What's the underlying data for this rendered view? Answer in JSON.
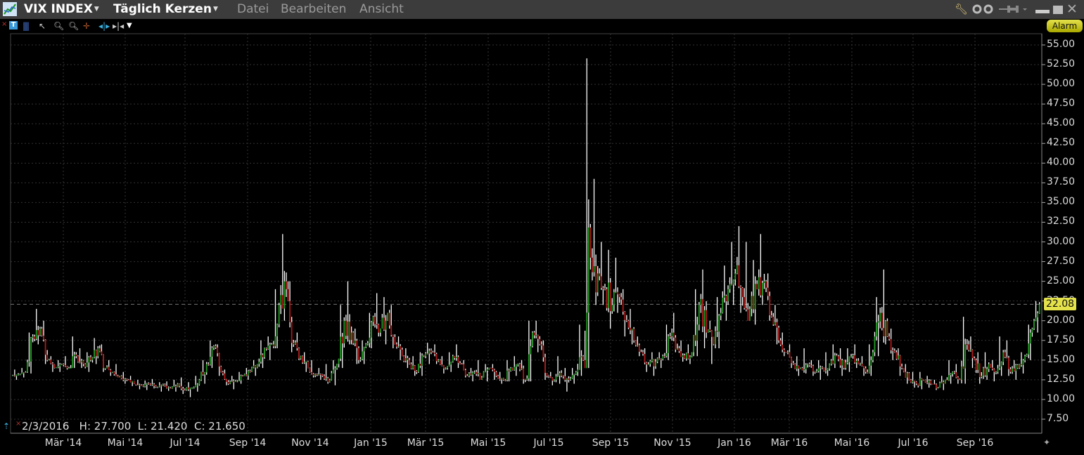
{
  "titlebar": {
    "symbol": "VIX INDEX",
    "chart_type": "Täglich Kerzen",
    "menus": [
      "Datei",
      "Bearbeiten",
      "Ansicht"
    ]
  },
  "alarm_label": "Alarm",
  "info": {
    "date": "2/3/2016",
    "text": "2/3/2016   H: 27.700  L: 21.420  C: 21.650"
  },
  "last_price": "22.08",
  "colors": {
    "up": "#1f9a1f",
    "down": "#b01818",
    "wick": "#ffffff",
    "last": "#e4e24a"
  },
  "chart_data": {
    "type": "candlestick",
    "title": "VIX INDEX",
    "interval": "weekly approximation of daily candles",
    "ylim": [
      5.0,
      57.0
    ],
    "yticks": [
      "55.00",
      "52.50",
      "50.00",
      "47.50",
      "45.00",
      "42.50",
      "40.00",
      "37.50",
      "35.00",
      "32.50",
      "30.00",
      "27.50",
      "25.00",
      "22.50",
      "20.00",
      "17.50",
      "15.00",
      "12.50",
      "10.00",
      "7.50"
    ],
    "xticks": [
      "Mär '14",
      "Mai '14",
      "Jul '14",
      "Sep '14",
      "Nov '14",
      "Jan '15",
      "Mär '15",
      "Mai '15",
      "Jul '15",
      "Sep '15",
      "Nov '15",
      "Jan '16",
      "Mär '16",
      "Mai '16",
      "Jul '16",
      "Sep '16"
    ],
    "last": 22.08,
    "ohlc": [
      [
        13,
        13.8,
        12.5,
        13.2
      ],
      [
        13.2,
        14,
        12.8,
        13.5
      ],
      [
        13.5,
        18.5,
        13.3,
        18
      ],
      [
        18,
        21.5,
        17,
        19
      ],
      [
        19,
        20,
        14.5,
        15
      ],
      [
        15,
        15.5,
        13.5,
        14
      ],
      [
        14,
        15,
        13.5,
        14.5
      ],
      [
        14.5,
        15.5,
        13.8,
        14
      ],
      [
        14,
        18,
        14,
        15.5
      ],
      [
        15.5,
        16.5,
        14,
        14.5
      ],
      [
        14.5,
        16,
        13.5,
        15
      ],
      [
        15,
        17.8,
        14.5,
        16.5
      ],
      [
        16.5,
        17,
        13.5,
        14
      ],
      [
        14,
        15,
        13,
        13.5
      ],
      [
        13.5,
        14.5,
        12.8,
        13
      ],
      [
        13,
        13.5,
        12,
        12.5
      ],
      [
        12.5,
        13,
        11.7,
        12
      ],
      [
        12,
        12.5,
        11.3,
        11.8
      ],
      [
        11.8,
        12.4,
        11.2,
        12
      ],
      [
        12,
        12.6,
        11.4,
        11.6
      ],
      [
        11.6,
        12.2,
        11,
        11.9
      ],
      [
        11.9,
        12.3,
        11.1,
        11.4
      ],
      [
        11.4,
        12.5,
        11,
        12
      ],
      [
        12,
        12.8,
        10.7,
        11.2
      ],
      [
        11.2,
        12.2,
        10.3,
        11.5
      ],
      [
        11.5,
        13,
        11,
        12.5
      ],
      [
        12.5,
        15,
        12,
        14.5
      ],
      [
        14.5,
        17.5,
        14,
        16.8
      ],
      [
        16.8,
        17,
        13,
        13.5
      ],
      [
        13.5,
        13.8,
        11.8,
        12
      ],
      [
        12,
        13,
        11.3,
        12.3
      ],
      [
        12.3,
        13.5,
        12,
        13
      ],
      [
        13,
        14,
        12.5,
        13.5
      ],
      [
        13.5,
        15,
        13,
        14.5
      ],
      [
        14.5,
        17.5,
        14,
        16.5
      ],
      [
        16.5,
        18,
        15,
        17
      ],
      [
        17,
        24,
        16.5,
        22
      ],
      [
        22,
        31,
        20,
        24
      ],
      [
        24,
        25,
        16,
        17
      ],
      [
        17,
        18.5,
        15,
        15.5
      ],
      [
        15.5,
        16,
        13.5,
        14
      ],
      [
        14,
        15,
        12.8,
        13.2
      ],
      [
        13.2,
        14,
        12.5,
        13
      ],
      [
        13,
        14.5,
        12,
        12.5
      ],
      [
        12.5,
        15,
        11.8,
        14.5
      ],
      [
        14.5,
        22,
        14,
        20
      ],
      [
        20,
        25,
        17,
        18.5
      ],
      [
        18.5,
        19,
        14.5,
        15
      ],
      [
        15,
        17.5,
        14.5,
        17
      ],
      [
        17,
        21,
        16.5,
        20.5
      ],
      [
        20.5,
        23.5,
        18,
        19
      ],
      [
        19,
        23,
        17,
        21
      ],
      [
        21,
        22,
        16.5,
        17
      ],
      [
        17,
        18,
        15,
        15.5
      ],
      [
        15.5,
        16.5,
        14,
        14.5
      ],
      [
        14.5,
        15.5,
        13,
        13.5
      ],
      [
        13.5,
        16,
        13,
        15.5
      ],
      [
        15.5,
        17.2,
        14.5,
        16
      ],
      [
        16,
        17,
        14.5,
        15
      ],
      [
        15,
        15.5,
        13.3,
        14
      ],
      [
        14,
        16,
        13.5,
        15.5
      ],
      [
        15.5,
        17,
        14,
        14.5
      ],
      [
        14.5,
        15,
        12.8,
        13
      ],
      [
        13,
        14,
        12.3,
        13.5
      ],
      [
        13.5,
        15,
        12.5,
        12.8
      ],
      [
        12.8,
        14.5,
        12.3,
        14
      ],
      [
        14,
        14.5,
        12.5,
        13
      ],
      [
        13,
        13.5,
        12,
        12.5
      ],
      [
        12.5,
        15,
        12.3,
        14
      ],
      [
        14,
        15.5,
        13,
        14.5
      ],
      [
        14.5,
        15,
        12,
        12.5
      ],
      [
        12.5,
        20,
        12.3,
        18.5
      ],
      [
        18.5,
        20,
        16,
        17
      ],
      [
        17,
        17.5,
        12.5,
        13
      ],
      [
        13,
        13.5,
        11.8,
        12.5
      ],
      [
        12.5,
        15.5,
        12,
        13
      ],
      [
        13,
        14,
        11,
        12.5
      ],
      [
        12.5,
        14,
        12,
        13.5
      ],
      [
        13.5,
        19.5,
        13,
        15
      ],
      [
        15,
        53.3,
        14,
        28
      ],
      [
        28,
        38,
        22,
        26
      ],
      [
        26,
        30,
        22,
        24
      ],
      [
        24,
        29,
        19,
        22
      ],
      [
        22,
        28,
        21,
        23
      ],
      [
        23,
        24,
        18,
        20
      ],
      [
        20,
        21.5,
        17,
        17.5
      ],
      [
        17.5,
        18,
        15.5,
        16
      ],
      [
        16,
        16.5,
        13.5,
        14.5
      ],
      [
        14.5,
        16,
        13,
        14.8
      ],
      [
        14.8,
        16,
        14,
        15.5
      ],
      [
        15.5,
        19.5,
        15,
        18
      ],
      [
        18,
        21,
        16,
        16.5
      ],
      [
        16.5,
        17.5,
        14.8,
        15.2
      ],
      [
        15.2,
        17,
        14.5,
        16
      ],
      [
        16,
        24,
        15.5,
        22
      ],
      [
        22,
        26.5,
        16.5,
        18.5
      ],
      [
        18.5,
        20,
        14.5,
        17
      ],
      [
        17,
        23,
        16.5,
        21
      ],
      [
        21,
        27,
        20,
        24
      ],
      [
        24,
        30,
        22,
        26
      ],
      [
        26,
        32,
        21,
        23
      ],
      [
        23,
        30,
        20,
        21.5
      ],
      [
        21.5,
        27.7,
        19.5,
        24
      ],
      [
        24,
        31,
        22,
        25
      ],
      [
        25,
        26,
        20,
        20.5
      ],
      [
        20.5,
        22,
        17,
        17.5
      ],
      [
        17.5,
        18.5,
        15.5,
        16
      ],
      [
        16,
        17,
        14,
        14.5
      ],
      [
        14.5,
        15.5,
        13,
        14
      ],
      [
        14,
        16.5,
        13.3,
        14.5
      ],
      [
        14.5,
        15,
        13,
        13.5
      ],
      [
        13.5,
        15,
        12.5,
        14
      ],
      [
        14,
        16,
        13,
        14.5
      ],
      [
        14.5,
        17,
        14,
        15.5
      ],
      [
        15.5,
        16.5,
        13,
        14
      ],
      [
        14,
        16.5,
        13.5,
        15.5
      ],
      [
        15.5,
        17,
        14,
        14.5
      ],
      [
        14.5,
        15.5,
        13,
        13.5
      ],
      [
        13.5,
        17,
        13,
        16
      ],
      [
        16,
        23,
        15.5,
        21
      ],
      [
        21,
        26.5,
        17,
        18
      ],
      [
        18,
        19,
        15,
        16
      ],
      [
        16,
        16.5,
        13,
        14
      ],
      [
        14,
        14.5,
        12,
        12.5
      ],
      [
        12.5,
        13.5,
        11.5,
        12
      ],
      [
        12,
        13.5,
        11.3,
        12.5
      ],
      [
        12.5,
        13,
        11.5,
        12
      ],
      [
        12,
        12.5,
        11.2,
        11.5
      ],
      [
        11.5,
        13,
        11.2,
        12.5
      ],
      [
        12.5,
        15,
        12,
        13.5
      ],
      [
        13.5,
        14.5,
        12,
        12.5
      ],
      [
        12.5,
        20.5,
        12,
        17
      ],
      [
        17,
        18,
        14,
        15
      ],
      [
        15,
        16,
        12,
        13
      ],
      [
        13,
        16,
        12.5,
        14.5
      ],
      [
        14.5,
        15,
        12.3,
        13.5
      ],
      [
        13.5,
        18,
        13,
        16
      ],
      [
        16,
        17.5,
        13,
        13.5
      ],
      [
        13.5,
        15,
        12.5,
        14
      ],
      [
        14,
        16,
        13.3,
        15.5
      ],
      [
        15.5,
        19.5,
        15,
        19
      ],
      [
        19,
        22.5,
        18.5,
        22.08
      ]
    ]
  }
}
